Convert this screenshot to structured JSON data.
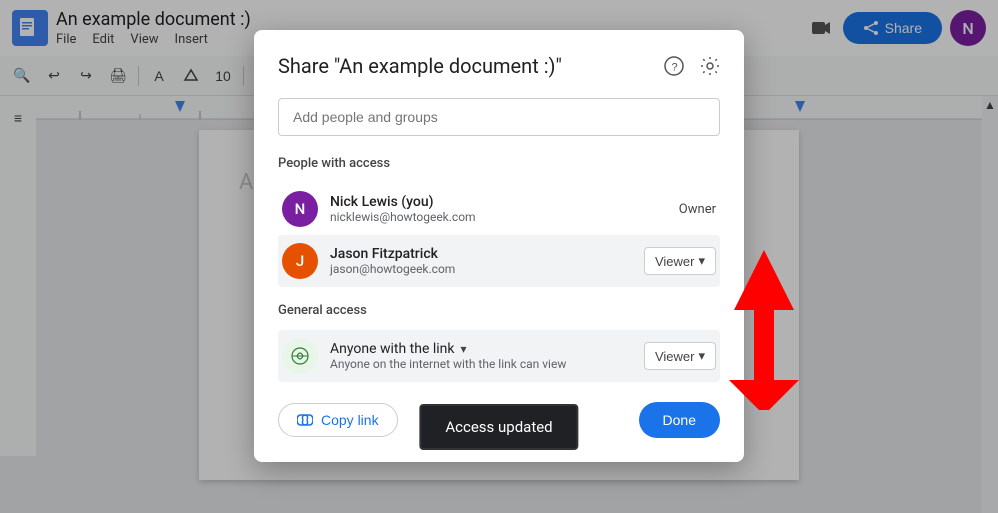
{
  "topbar": {
    "doc_title": "An example document :)",
    "menu_items": [
      "File",
      "Edit",
      "View",
      "Insert"
    ],
    "share_label": "Share",
    "avatar_letter": "N"
  },
  "toolbar": {
    "buttons": [
      "🔍",
      "↩",
      "↪",
      "🖨",
      "A",
      "📝",
      "10"
    ]
  },
  "modal": {
    "title": "Share \"An example document :)\"",
    "help_icon": "?",
    "settings_icon": "⚙",
    "search_placeholder": "Add people and groups",
    "people_section_title": "People with access",
    "people": [
      {
        "name": "Nick Lewis (you)",
        "email": "nicklewis@howtogeek.com",
        "role": "Owner",
        "avatar_letter": "N",
        "avatar_color": "purple"
      },
      {
        "name": "Jason Fitzpatrick",
        "email": "jason@howtogeek.com",
        "role": "Viewer",
        "avatar_letter": "J",
        "avatar_color": "orange"
      }
    ],
    "general_access_title": "General access",
    "access_type": "Anyone with the link",
    "access_subtitle": "Anyone on the internet with the link can view",
    "access_role": "Viewer",
    "copy_link_label": "Copy link",
    "done_label": "Done"
  },
  "toast": {
    "message": "Access updated"
  }
}
